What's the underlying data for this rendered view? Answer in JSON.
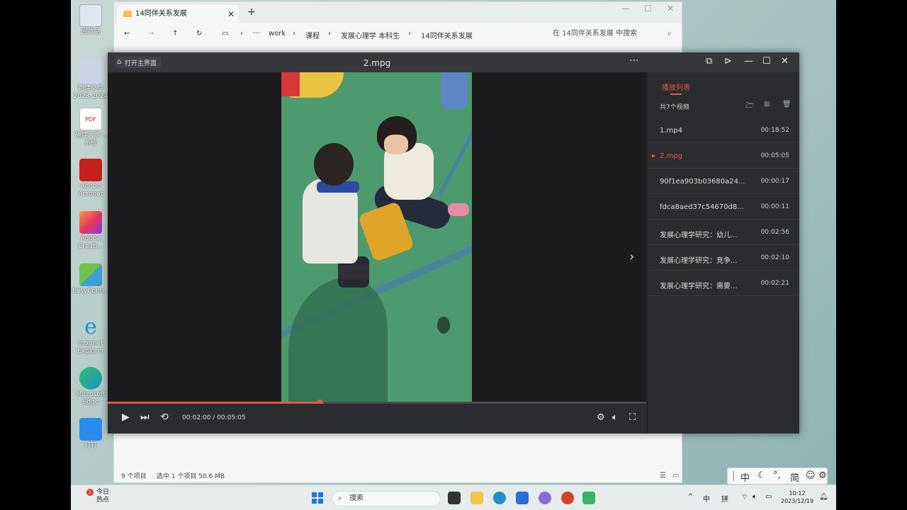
{
  "desktop": {
    "icons": [
      {
        "label": "回收站",
        "icon": "recycle-bin-icon",
        "color": "#dfe6ee"
      },
      {
        "label": "新建文件 2023-2024",
        "icon": "document-thumbnail-icon",
        "color": "#c8d4e6"
      },
      {
        "label": "福建大学...系统",
        "icon": "pdf-icon",
        "color": "#ffffff"
      },
      {
        "label": "Adobe Acrobat",
        "icon": "adobe-acrobat-icon",
        "color": "#c6201a"
      },
      {
        "label": "Adobe Creati...",
        "icon": "adobe-creative-cloud-icon",
        "color": "#e8365d"
      },
      {
        "label": "EasyConn...",
        "icon": "easyconnect-icon",
        "color": "#3f9fd6"
      },
      {
        "label": "Internet Explorer",
        "icon": "internet-explorer-icon",
        "color": "#1d8fe0"
      },
      {
        "label": "Microsoft Edge",
        "icon": "edge-icon",
        "color": "#1f8fc9"
      },
      {
        "label": "钉钉",
        "icon": "dingtalk-icon",
        "color": "#2b8cf0"
      }
    ]
  },
  "explorer": {
    "tab_title": "14同伴关系发展",
    "tab_close": "✕",
    "new_tab": "+",
    "breadcrumb": [
      "work",
      "课程",
      "发展心理学 本科生",
      "14同伴关系发展"
    ],
    "more": "···",
    "search_placeholder": "在 14同伴关系发展 中搜索",
    "status": {
      "items": "9 个项目",
      "selected": "选中 1 个项目  50.6 MB"
    }
  },
  "player": {
    "home_label": "打开主界面",
    "file_name": "2.mpg",
    "progress": {
      "current": "00:02:00",
      "total": "00:05:05",
      "fraction": 0.393
    },
    "time_display": "00:02:00 / 00:05:05",
    "playlist": {
      "tab_label": "播放列表",
      "count_label": "共7个视频",
      "items": [
        {
          "name": "1.mp4",
          "duration": "00:18:52",
          "active": false
        },
        {
          "name": "2.mpg",
          "duration": "00:05:05",
          "active": true
        },
        {
          "name": "90f1ea903b03680a24...",
          "duration": "00:00:17",
          "active": false
        },
        {
          "name": "fdca8aed37c54670d8...",
          "duration": "00:00:11",
          "active": false
        },
        {
          "name": "发展心理学研究：幼儿...",
          "duration": "00:02:56",
          "active": false
        },
        {
          "name": "发展心理学研究：竞争...",
          "duration": "00:02:10",
          "active": false
        },
        {
          "name": "发展心理学研究：需要...",
          "duration": "00:02:21",
          "active": false
        }
      ]
    },
    "accent_color": "#e8554a"
  },
  "taskbar": {
    "weather": {
      "badge": "1",
      "line1": "今日",
      "line2": "热点"
    },
    "search_label": "搜索",
    "tray": {
      "chevron": "^",
      "ime_mode": "中",
      "ime_pinyin": "拼"
    },
    "clock": {
      "time": "10:12",
      "date": "2023/12/19"
    },
    "apps": [
      {
        "icon": "taskview-icon",
        "color": "#333333"
      },
      {
        "icon": "file-explorer-icon",
        "color": "#f4c24a"
      },
      {
        "icon": "edge-icon",
        "color": "#1f8fc9"
      },
      {
        "icon": "store-icon",
        "color": "#2a6fd1"
      },
      {
        "icon": "copilot-icon",
        "color": "#8b6bd6"
      },
      {
        "icon": "powerpoint-icon",
        "color": "#d04423"
      },
      {
        "icon": "video-player-icon",
        "color": "#38b26b"
      }
    ]
  },
  "ime_bar": {
    "items": [
      "中",
      "简"
    ]
  }
}
